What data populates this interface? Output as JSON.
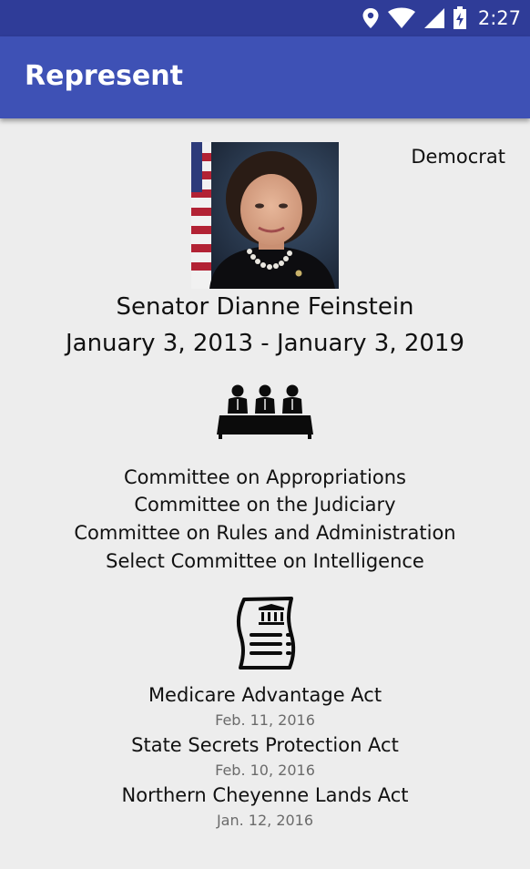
{
  "status_bar": {
    "time": "2:27",
    "icons": [
      "location-icon",
      "wifi-icon",
      "signal-icon",
      "battery-icon"
    ]
  },
  "app_bar": {
    "title": "Represent"
  },
  "representative": {
    "party": "Democrat",
    "name": "Senator Dianne Feinstein",
    "term": "January 3, 2013 - January 3, 2019"
  },
  "committees": [
    "Committee on Appropriations",
    "Committee on the Judiciary",
    "Committee on Rules and Administration",
    "Select Committee on Intelligence"
  ],
  "bills": [
    {
      "name": "Medicare Advantage Act",
      "date": "Feb. 11, 2016"
    },
    {
      "name": "State Secrets Protection Act",
      "date": "Feb. 10, 2016"
    },
    {
      "name": "Northern Cheyenne Lands Act",
      "date": "Jan. 12, 2016"
    }
  ],
  "colors": {
    "status_bar": "#2f3c98",
    "app_bar": "#3e51b5",
    "background": "#ededed"
  }
}
